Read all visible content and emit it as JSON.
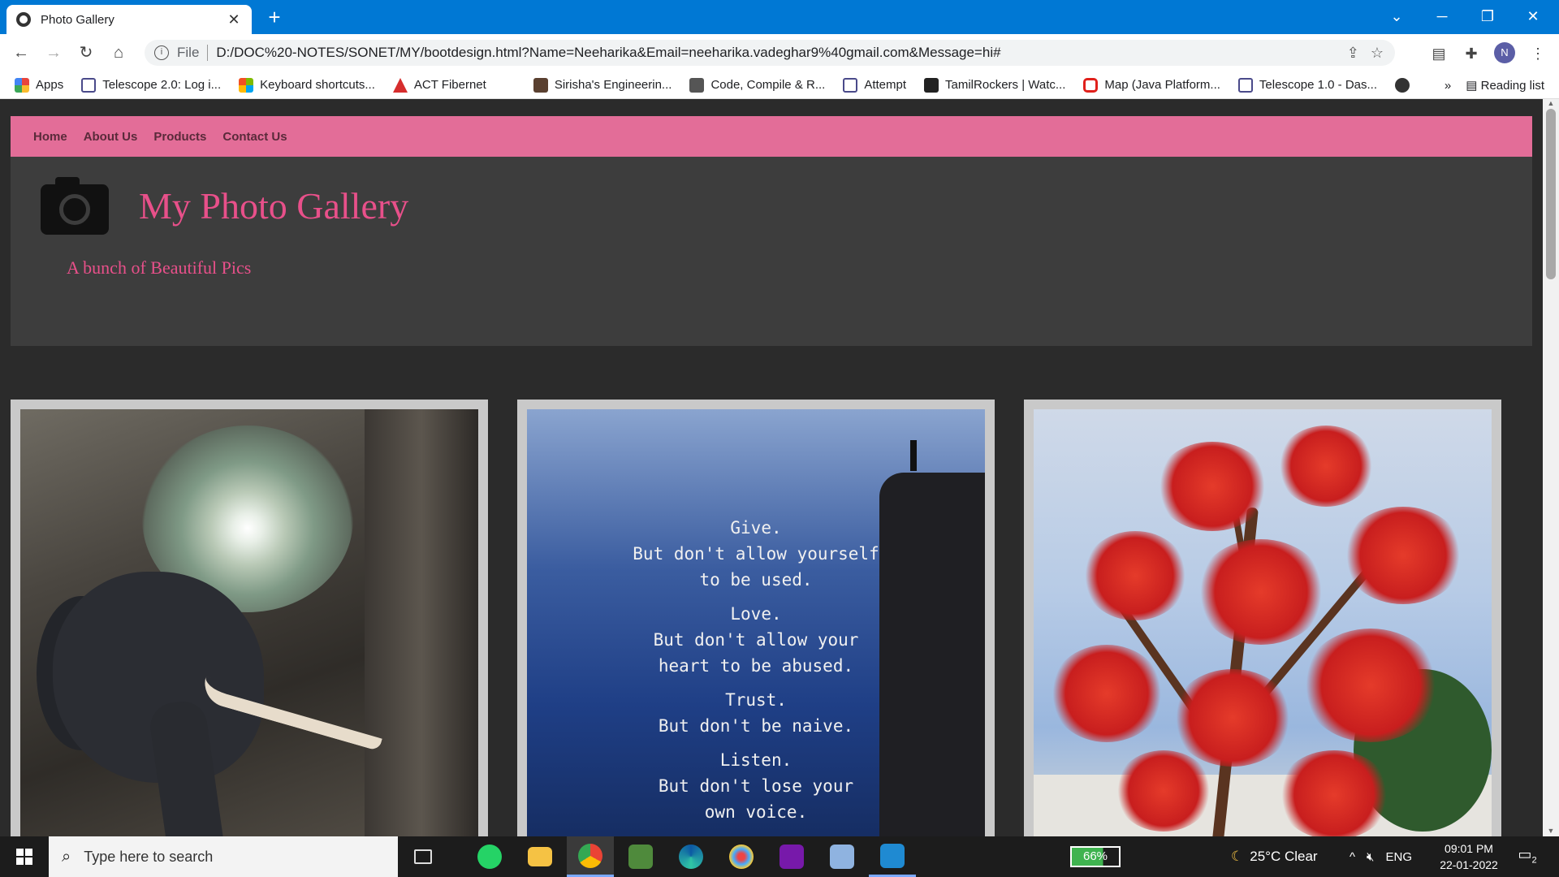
{
  "browser": {
    "tab_title": "Photo Gallery",
    "tab_close": "✕",
    "new_tab": "+",
    "url_scheme": "File",
    "url": "D:/DOC%20-NOTES/SONET/MY/bootdesign.html?Name=Neeharika&Email=neeharika.vadeghar9%40gmail.com&Message=hi#",
    "profile_initial": "N",
    "reading_list": "Reading list",
    "bookmarks_overflow": "»",
    "bookmarks": [
      {
        "label": "Apps",
        "icon": "apps-grid-icon",
        "color": "#e8453c"
      },
      {
        "label": "Telescope 2.0: Log i...",
        "icon": "telescope-icon",
        "color": "#4a4a8a"
      },
      {
        "label": "Keyboard shortcuts...",
        "icon": "microsoft-icon",
        "color": "#f25022"
      },
      {
        "label": "ACT Fibernet",
        "icon": "act-icon",
        "color": "#d62d2d"
      },
      {
        "label": "Sirisha's Engineerin...",
        "icon": "avatar-icon",
        "color": "#5a4030"
      },
      {
        "label": "Code, Compile & R...",
        "icon": "cc-icon",
        "color": "#555555"
      },
      {
        "label": "Attempt",
        "icon": "telescope-icon",
        "color": "#4a4a8a"
      },
      {
        "label": "TamilRockers | Watc...",
        "icon": "tr-icon",
        "color": "#222222"
      },
      {
        "label": "Map (Java Platform...",
        "icon": "oracle-icon",
        "color": "#e0201b"
      },
      {
        "label": "Telescope 1.0 - Das...",
        "icon": "telescope-icon",
        "color": "#4a4a8a"
      }
    ]
  },
  "site": {
    "nav": [
      "Home",
      "About Us",
      "Products",
      "Contact Us"
    ],
    "title": "My Photo Gallery",
    "tagline": "A bunch of Beautiful Pics",
    "quote_lines": [
      [
        "Give.",
        "But don't allow yourself",
        "to be used."
      ],
      [
        "Love.",
        "But don't allow your",
        "heart to be abused."
      ],
      [
        "Trust.",
        "But don't be naive."
      ],
      [
        "Listen.",
        "But don't lose your",
        "own voice."
      ]
    ]
  },
  "taskbar": {
    "search_placeholder": "Type here to search",
    "battery": "66%",
    "weather": "25°C  Clear",
    "language": "ENG",
    "time": "09:01 PM",
    "date": "22-01-2022",
    "notification_count": "2"
  }
}
